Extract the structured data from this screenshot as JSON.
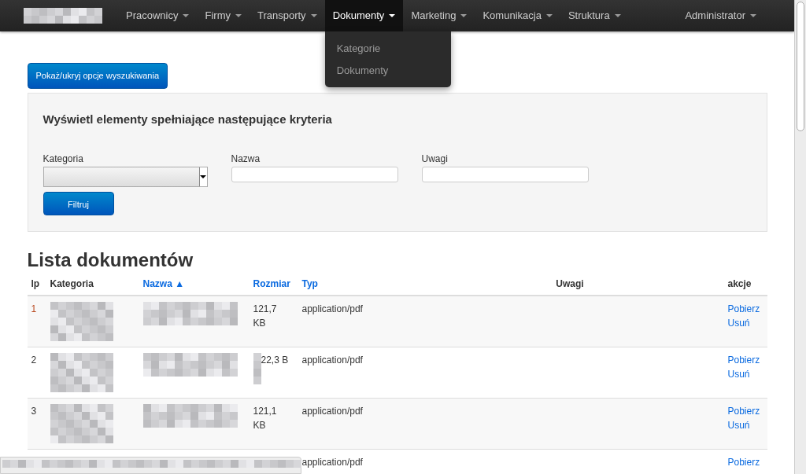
{
  "navbar": {
    "items": [
      {
        "label": "Pracownicy",
        "selected": false
      },
      {
        "label": "Firmy",
        "selected": false
      },
      {
        "label": "Transporty",
        "selected": false
      },
      {
        "label": "Dokumenty",
        "selected": true,
        "menu": [
          "Kategorie",
          "Dokumenty"
        ]
      },
      {
        "label": "Marketing",
        "selected": false
      },
      {
        "label": "Komunikacja",
        "selected": false
      },
      {
        "label": "Struktura",
        "selected": false
      }
    ],
    "user": {
      "label": "Administrator"
    }
  },
  "toggle_button": "Pokaż/ukryj opcje wyszukiwania",
  "search": {
    "title": "Wyświetl elementy spełniające następujące kryteria",
    "fields": [
      {
        "kind": "select",
        "label": "Kategoria"
      },
      {
        "kind": "text",
        "label": "Nazwa"
      },
      {
        "kind": "text",
        "label": "Uwagi"
      }
    ],
    "button": "Filtruj"
  },
  "list": {
    "title": "Lista dokumentów",
    "columns": [
      {
        "label": "lp",
        "sortable": false
      },
      {
        "label": "Kategoria",
        "sortable": false
      },
      {
        "label": "Nazwa",
        "sortable": true,
        "sort_indicator": "▲"
      },
      {
        "label": "Rozmiar",
        "sortable": true
      },
      {
        "label": "Typ",
        "sortable": true
      },
      {
        "label": "Uwagi",
        "sortable": false
      },
      {
        "label": "akcje",
        "sortable": false
      }
    ],
    "rows": [
      {
        "lp": "1",
        "highlighted": true,
        "size": "121,7 KB",
        "size_covered": false,
        "type": "application/pdf",
        "actions": [
          "Pobierz",
          "Usuń"
        ]
      },
      {
        "lp": "2",
        "highlighted": false,
        "size": "22,3 B",
        "size_covered": true,
        "type": "application/pdf",
        "actions": [
          "Pobierz",
          "Usuń"
        ]
      },
      {
        "lp": "3",
        "highlighted": false,
        "size": "121,1 KB",
        "size_covered": false,
        "type": "application/pdf",
        "actions": [
          "Pobierz",
          "Usuń"
        ]
      },
      {
        "type": "application/pdf",
        "actions": [
          "Pobierz"
        ]
      }
    ]
  }
}
